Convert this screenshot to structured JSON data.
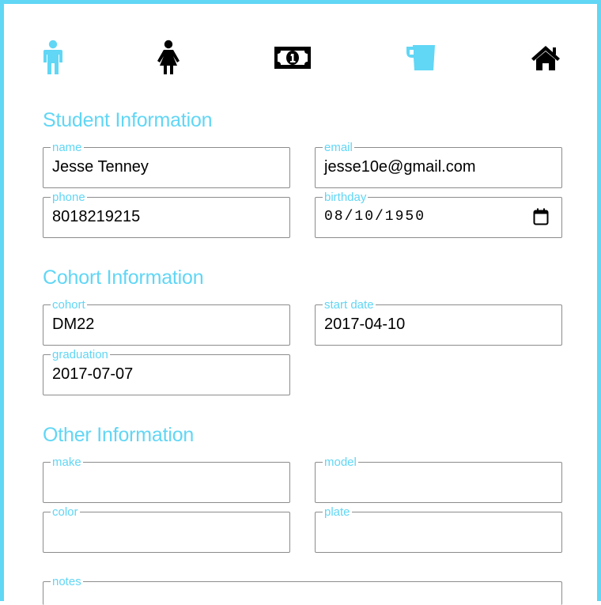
{
  "nav": {
    "icons": [
      {
        "name": "male-icon",
        "color": "#61d6f5"
      },
      {
        "name": "female-icon",
        "color": "#000000"
      },
      {
        "name": "money-icon",
        "color": "#000000"
      },
      {
        "name": "cup-icon",
        "color": "#61d6f5"
      },
      {
        "name": "home-icon",
        "color": "#000000"
      }
    ]
  },
  "colors": {
    "accent": "#61d6f5",
    "border": "#8c8c8c"
  },
  "student": {
    "title": "Student Information",
    "name": {
      "label": "name",
      "value": "Jesse Tenney"
    },
    "email": {
      "label": "email",
      "value": "jesse10e@gmail.com"
    },
    "phone": {
      "label": "phone",
      "value": "8018219215"
    },
    "birthday": {
      "label": "birthday",
      "value": "08/10/1950"
    }
  },
  "cohort": {
    "title": "Cohort Information",
    "cohort": {
      "label": "cohort",
      "value": "DM22"
    },
    "start_date": {
      "label": "start date",
      "value": "2017-04-10"
    },
    "graduation": {
      "label": "graduation",
      "value": "2017-07-07"
    }
  },
  "other": {
    "title": "Other Information",
    "make": {
      "label": "make",
      "value": ""
    },
    "model": {
      "label": "model",
      "value": ""
    },
    "color": {
      "label": "color",
      "value": ""
    },
    "plate": {
      "label": "plate",
      "value": ""
    },
    "notes": {
      "label": "notes",
      "value": ""
    }
  }
}
